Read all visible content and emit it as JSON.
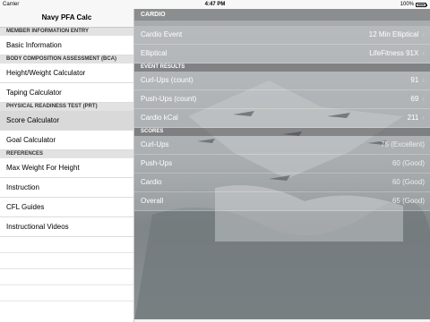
{
  "status_bar": {
    "carrier": "Carrier",
    "time": "4:47 PM",
    "battery": "100%"
  },
  "sidebar": {
    "title": "Navy PFA Calc",
    "sections": [
      {
        "header": "MEMBER INFORMATION ENTRY",
        "items": [
          {
            "label": "Basic Information"
          }
        ]
      },
      {
        "header": "BODY COMPOSITION ASSESSMENT (BCA)",
        "items": [
          {
            "label": "Height/Weight Calculator"
          },
          {
            "label": "Taping Calculator"
          }
        ]
      },
      {
        "header": "PHYSICAL READINESS TEST (PRT)",
        "items": [
          {
            "label": "Score Calculator",
            "selected": true
          },
          {
            "label": "Goal Calculator"
          }
        ]
      },
      {
        "header": "REFERENCES",
        "items": [
          {
            "label": "Max Weight For Height"
          },
          {
            "label": "Instruction"
          },
          {
            "label": "CFL Guides"
          },
          {
            "label": "Instructional Videos"
          }
        ]
      }
    ]
  },
  "main": {
    "header": "CARDIO",
    "cardio": [
      {
        "label": "Cardio Event",
        "value": "12 Min Elliptical"
      },
      {
        "label": "Elliptical",
        "value": "LifeFitness 91X"
      }
    ],
    "event_results_header": "EVENT RESULTS",
    "event_results": [
      {
        "label": "Curl-Ups (count)",
        "value": "91"
      },
      {
        "label": "Push-Ups (count)",
        "value": "69"
      },
      {
        "label": "Cardio kCal",
        "value": "211"
      }
    ],
    "scores_header": "SCORES",
    "scores": [
      {
        "label": "Curl-Ups",
        "value": "75 (Excellent)"
      },
      {
        "label": "Push-Ups",
        "value": "60 (Good)"
      },
      {
        "label": "Cardio",
        "value": "60 (Good)"
      },
      {
        "label": "Overall",
        "value": "65 (Good)"
      }
    ]
  }
}
